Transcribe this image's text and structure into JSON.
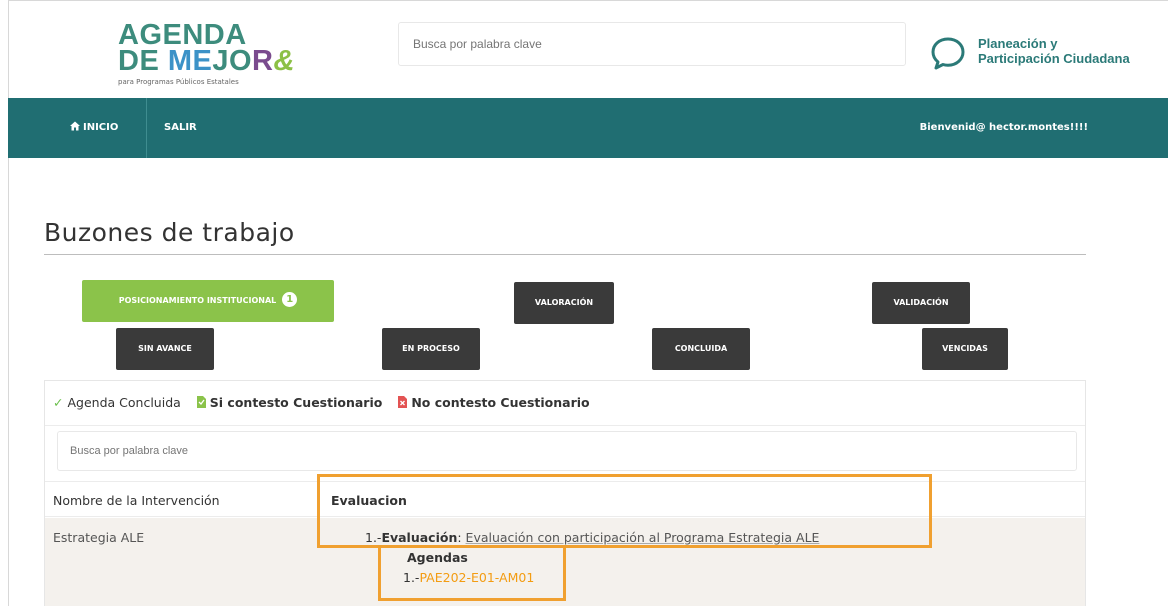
{
  "header": {
    "logo_line1": "AGENDA",
    "logo_de": "DE ",
    "logo_me": "ME",
    "logo_jo": "JO",
    "logo_ra": "R",
    "logo_amp": "&",
    "logo_tagline": "para Programas Públicos Estatales",
    "search_placeholder": "Busca por palabra clave",
    "brand_line1": "Planeación y",
    "brand_line2": "Participación Ciudadana"
  },
  "nav": {
    "inicio": "INICIO",
    "salir": "SALIR",
    "welcome": "Bienvenid@ hector.montes!!!!"
  },
  "main": {
    "title": "Buzones de trabajo",
    "buttons": {
      "posicionamiento": "POSICIONAMIENTO INSTITUCIONAL",
      "posicionamiento_badge": "1",
      "valoracion": "VALORACIÓN",
      "validacion": "VALIDACIÓN",
      "sin_avance": "SIN AVANCE",
      "en_proceso": "EN PROCESO",
      "concluida": "CONCLUIDA",
      "vencidas": "VENCIDAS"
    },
    "legend": {
      "concluida": "Agenda Concluida",
      "si_contesto": "Si contesto Cuestionario",
      "no_contesto": "No contesto Cuestionario"
    },
    "filter_placeholder": "Busca por palabra clave",
    "table": {
      "col1": "Nombre de la Intervención",
      "col2": "Evaluacion",
      "row": {
        "name": "Estrategia ALE",
        "eval_prefix": "1.-",
        "eval_label": "Evaluación",
        "eval_sep": ": ",
        "eval_desc": "Evaluación con participación al Programa Estrategia ALE",
        "agendas_label": "Agendas",
        "agenda_prefix": "1.-",
        "agenda_code": "PAE202-E01-AM01"
      }
    }
  },
  "colors": {
    "navbar": "#206e72",
    "green_button": "#8bc34a",
    "dark_button": "#3a3a3a",
    "highlight": "#f0a030",
    "agenda_link": "#f39c12"
  }
}
